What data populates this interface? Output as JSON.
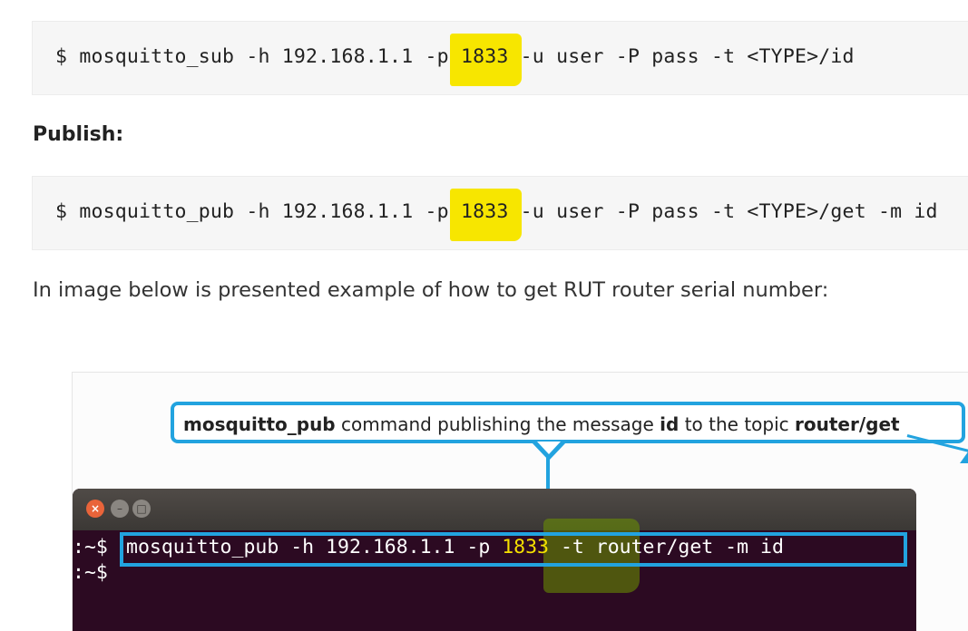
{
  "subscribe": {
    "prompt": "$",
    "cmd_before": "mosquitto_sub -h 192.168.1.1 -p ",
    "port": "1833",
    "cmd_after": " -u user -P pass -t <TYPE>/id"
  },
  "publish_heading": "Publish:",
  "publish": {
    "prompt": "$",
    "cmd_before": "mosquitto_pub -h 192.168.1.1 -p ",
    "port": "1833",
    "cmd_after": " -u user -P pass -t <TYPE>/get -m id"
  },
  "intro_text": "In image below is presented example of how to get RUT router serial number:",
  "figure": {
    "callout": {
      "cmd_name": "mosquitto_pub",
      "text1": " command publishing the message ",
      "message": "id",
      "text2": " to the topic ",
      "topic": "router/get"
    },
    "terminal": {
      "close_glyph": "×",
      "min_glyph": "–",
      "max_glyph": "□",
      "prompt": ":~$",
      "cmd_before": "mosquitto_pub -h 192.168.1.1 -p ",
      "port": "1833",
      "cmd_after": " -t router/get -m id",
      "prompt2": ":~$"
    }
  },
  "colors": {
    "highlight": "#f7e600",
    "callout_blue": "#22a3df",
    "terminal_bg": "#2c0a22"
  }
}
